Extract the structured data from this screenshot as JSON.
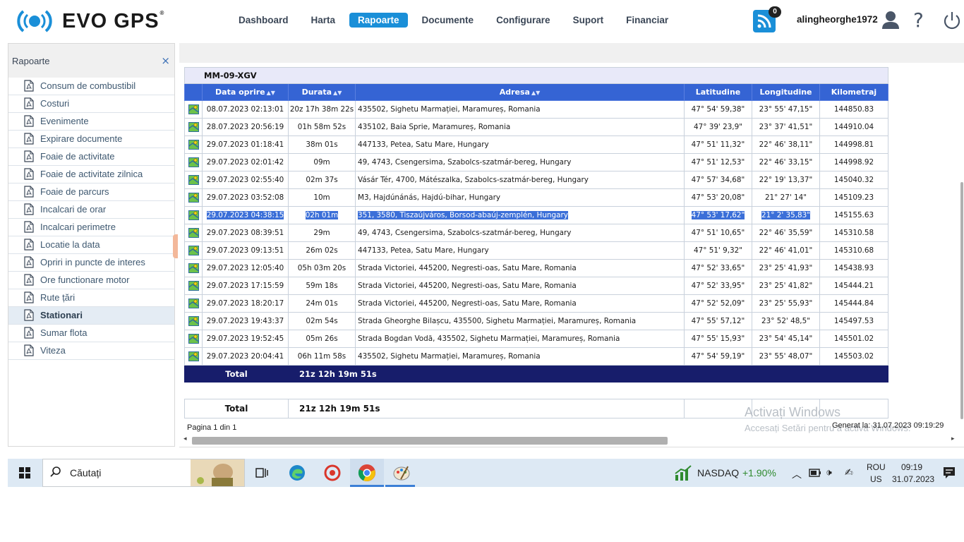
{
  "header": {
    "logo_text": "EVO GPS",
    "logo_reg": "®",
    "nav": [
      "Dashboard",
      "Harta",
      "Rapoarte",
      "Documente",
      "Configurare",
      "Suport",
      "Financiar"
    ],
    "active_nav": "Rapoarte",
    "notifications_count": "0",
    "username": "alingheorghe1972",
    "help": "?"
  },
  "sidebar": {
    "title": "Rapoarte",
    "close": "×",
    "items": [
      {
        "label": "Consum de combustibil"
      },
      {
        "label": "Costuri"
      },
      {
        "label": "Evenimente"
      },
      {
        "label": "Expirare documente"
      },
      {
        "label": "Foaie de activitate"
      },
      {
        "label": "Foaie de activitate zilnica"
      },
      {
        "label": "Foaie de parcurs"
      },
      {
        "label": "Incalcari de orar"
      },
      {
        "label": "Incalcari perimetre"
      },
      {
        "label": "Locatie la data"
      },
      {
        "label": "Opriri in puncte de interes"
      },
      {
        "label": "Ore functionare motor"
      },
      {
        "label": "Rute țări"
      },
      {
        "label": "Stationari"
      },
      {
        "label": "Sumar flota"
      },
      {
        "label": "Viteza"
      }
    ],
    "active_item": "Stationari"
  },
  "report": {
    "vehicle": "MM-09-XGV",
    "columns": [
      "Data oprire",
      "Durata",
      "Adresa",
      "Latitudine",
      "Longitudine",
      "Kilometraj"
    ],
    "rows": [
      {
        "date": "08.07.2023 02:13:01",
        "dur": "20z 17h 38m 22s",
        "addr": "435502, Sighetu Marmației, Maramureș, Romania",
        "lat": "47° 54' 59,38\"",
        "lon": "23° 55' 47,15\"",
        "km": "144850.83"
      },
      {
        "date": "28.07.2023 20:56:19",
        "dur": "01h 58m 52s",
        "addr": "435102, Baia Sprie, Maramureș, Romania",
        "lat": "47° 39' 23,9\"",
        "lon": "23° 37' 41,51\"",
        "km": "144910.04"
      },
      {
        "date": "29.07.2023 01:18:41",
        "dur": "38m 01s",
        "addr": "447133, Petea, Satu Mare, Hungary",
        "lat": "47° 51' 11,32\"",
        "lon": "22° 46' 38,11\"",
        "km": "144998.81"
      },
      {
        "date": "29.07.2023 02:01:42",
        "dur": "09m",
        "addr": "49,  4743, Csengersima, Szabolcs-szatmár-bereg, Hungary",
        "lat": "47° 51' 12,53\"",
        "lon": "22° 46' 33,15\"",
        "km": "144998.92"
      },
      {
        "date": "29.07.2023 02:55:40",
        "dur": "02m 37s",
        "addr": "Vásár Tér,  4700, Mátészalka, Szabolcs-szatmár-bereg, Hungary",
        "lat": "47° 57' 34,68\"",
        "lon": "22° 19' 13,37\"",
        "km": "145040.32"
      },
      {
        "date": "29.07.2023 03:52:08",
        "dur": "10m",
        "addr": "M3,   Hajdúnánás, Hajdú-bihar, Hungary",
        "lat": "47° 53' 20,08\"",
        "lon": "21° 27' 14\"",
        "km": "145109.23"
      },
      {
        "date": "29.07.2023 04:38:15",
        "dur": "02h 01m",
        "addr": "351,  3580, Tiszaújváros, Borsod-abaúj-zemplén, Hungary",
        "lat": "47° 53' 17,62\"",
        "lon": "21° 2' 35,83\"",
        "km": "145155.63",
        "selected": true
      },
      {
        "date": "29.07.2023 08:39:51",
        "dur": "29m",
        "addr": "49,  4743, Csengersima, Szabolcs-szatmár-bereg, Hungary",
        "lat": "47° 51' 10,65\"",
        "lon": "22° 46' 35,59\"",
        "km": "145310.58"
      },
      {
        "date": "29.07.2023 09:13:51",
        "dur": "26m 02s",
        "addr": "447133, Petea, Satu Mare, Hungary",
        "lat": "47° 51' 9,32\"",
        "lon": "22° 46' 41,01\"",
        "km": "145310.68"
      },
      {
        "date": "29.07.2023 12:05:40",
        "dur": "05h 03m 20s",
        "addr": "Strada Victoriei,  445200, Negresti-oas, Satu Mare, Romania",
        "lat": "47° 52' 33,65\"",
        "lon": "23° 25' 41,93\"",
        "km": "145438.93"
      },
      {
        "date": "29.07.2023 17:15:59",
        "dur": "59m 18s",
        "addr": "Strada Victoriei,  445200, Negresti-oas, Satu Mare, Romania",
        "lat": "47° 52' 33,95\"",
        "lon": "23° 25' 41,82\"",
        "km": "145444.21"
      },
      {
        "date": "29.07.2023 18:20:17",
        "dur": "24m 01s",
        "addr": "Strada Victoriei,  445200, Negresti-oas, Satu Mare, Romania",
        "lat": "47° 52' 52,09\"",
        "lon": "23° 25' 55,93\"",
        "km": "145444.84"
      },
      {
        "date": "29.07.2023 19:43:37",
        "dur": "02m 54s",
        "addr": "Strada Gheorghe Bilașcu,  435500, Sighetu Marmației, Maramureș, Romania",
        "lat": "47° 55' 57,12\"",
        "lon": "23° 52' 48,5\"",
        "km": "145497.53"
      },
      {
        "date": "29.07.2023 19:52:45",
        "dur": "05m 26s",
        "addr": "Strada Bogdan Vodă,  435502, Sighetu Marmației, Maramureș, Romania",
        "lat": "47° 55' 15,93\"",
        "lon": "23° 54' 45,14\"",
        "km": "145501.02"
      },
      {
        "date": "29.07.2023 20:04:41",
        "dur": "06h 11m 58s",
        "addr": "435502, Sighetu Marmației, Maramureș, Romania",
        "lat": "47° 54' 59,19\"",
        "lon": "23° 55' 48,07\"",
        "km": "145503.02"
      }
    ],
    "total_label": "Total",
    "total_value": "21z 12h 19m 51s",
    "grand_total_label": "Total",
    "grand_total_value": "21z 12h 19m 51s",
    "pagination": "Pagina 1 din 1",
    "generated": "Generat la: 31.07.2023 09:19:29"
  },
  "watermark": {
    "line1": "Activați Windows",
    "line2": "Accesați Setări pentru a activa Windows."
  },
  "taskbar": {
    "search_placeholder": "Căutați",
    "nasdaq_label": "NASDAQ",
    "nasdaq_change": "+1.90%",
    "lang_top": "ROU",
    "lang_bottom": "US",
    "time": "09:19",
    "date": "31.07.2023"
  },
  "colors": {
    "accent": "#1a8fd8",
    "table_header": "#3564d4",
    "total_row": "#171d6b",
    "selection": "#3b6fd8"
  }
}
